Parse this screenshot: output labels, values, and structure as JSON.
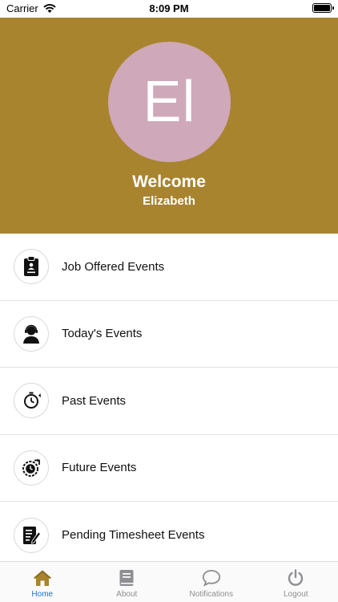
{
  "status_bar": {
    "carrier": "Carrier",
    "time": "8:09 PM"
  },
  "header": {
    "avatar_initials": "El",
    "welcome": "Welcome",
    "name": "Elizabeth",
    "background_color": "#a8842f",
    "avatar_color": "#cfa9b9"
  },
  "menu": {
    "items": [
      {
        "label": "Job Offered Events",
        "icon": "clipboard-icon"
      },
      {
        "label": "Today's Events",
        "icon": "support-agent-icon"
      },
      {
        "label": "Past Events",
        "icon": "clock-back-icon"
      },
      {
        "label": "Future Events",
        "icon": "clock-forward-icon"
      },
      {
        "label": "Pending Timesheet Events",
        "icon": "timesheet-edit-icon"
      }
    ]
  },
  "tab_bar": {
    "active_color": "#1e73d6",
    "tabs": [
      {
        "label": "Home",
        "icon": "home-icon",
        "active": true
      },
      {
        "label": "About",
        "icon": "book-icon",
        "active": false
      },
      {
        "label": "Notifications",
        "icon": "chat-bubble-icon",
        "active": false
      },
      {
        "label": "Logout",
        "icon": "power-icon",
        "active": false
      }
    ]
  }
}
